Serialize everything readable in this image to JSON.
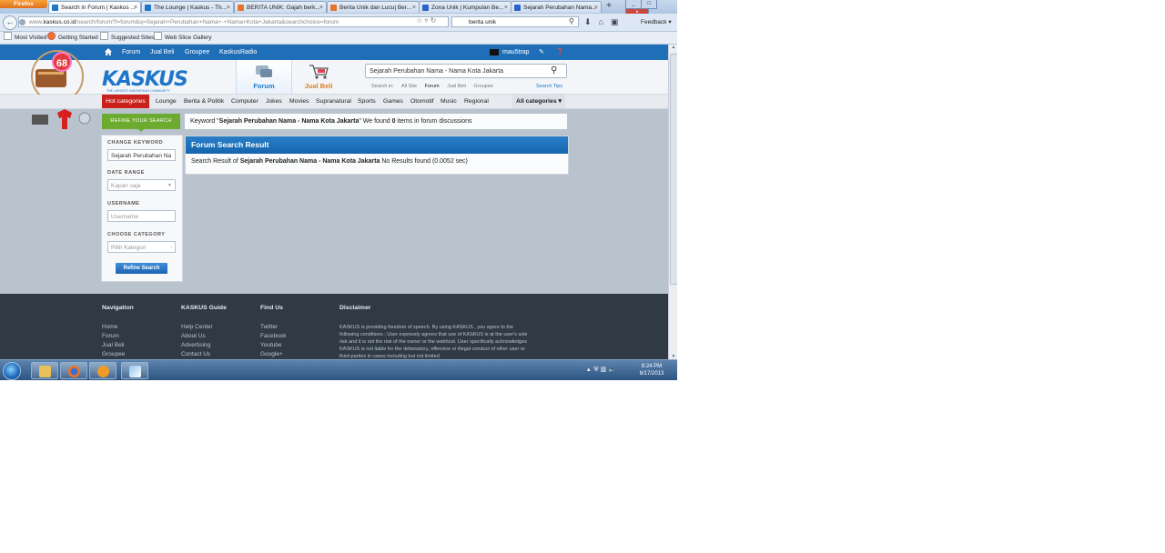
{
  "browser": {
    "app_button": "Firefox",
    "tabs": [
      {
        "title": "Search in Forum | Kaskus ...",
        "color": "#1e75c9"
      },
      {
        "title": "The Lounge | Kaskus - Th...",
        "color": "#1e75c9"
      },
      {
        "title": "BERITA UNIK: Gajah berk...",
        "color": "#e8742a"
      },
      {
        "title": "Berita Unik dan Lucu| Ber...",
        "color": "#e8742a"
      },
      {
        "title": "Zona Unik | Kumpulan Be...",
        "color": "#2a63c9"
      },
      {
        "title": "Sejarah Perubahan Nama...",
        "color": "#2a63c9"
      }
    ],
    "url_prefix": "www.",
    "url_domain": "kaskus.co.id",
    "url_path": "/search/forum?f=forum&q=Sejarah+Perubahan+Nama+-+Nama+Kota+Jakarta&searchchoice=forum",
    "search_value": "berita unik",
    "feedback": "Feedback",
    "bookmarks": [
      "Most Visited",
      "Getting Started",
      "Suggested Sites",
      "Web Slice Gallery"
    ]
  },
  "site": {
    "topnav": [
      "Forum",
      "Jual Beli",
      "Groupee",
      "KaskusRadio"
    ],
    "username": "mau5trap",
    "logo": "KASKUS",
    "logo_tagline": "THE LARGEST INDONESIAN COMMUNITY",
    "anniversary_badge": "68",
    "header_tabs": {
      "forum": "Forum",
      "jual_beli": "Jual Beli"
    },
    "search_value": "Sejarah Perubahan Nama - Nama Kota Jakarta",
    "search_in_label": "Search in:",
    "search_in_options": [
      "All Site",
      "Forum",
      "Jual Beli",
      "Groupee"
    ],
    "search_tips": "Search Tips",
    "hot_categories": "Hot categories",
    "categories": [
      "Lounge",
      "Berita & Politik",
      "Computer",
      "Jokes",
      "Movies",
      "Supranatural",
      "Sports",
      "Games",
      "Otomotif",
      "Music",
      "Regional"
    ],
    "all_categories": "All categories"
  },
  "search": {
    "refine_tag": "REFINE YOUR SEARCH",
    "keyword_prefix": "Keyword \"",
    "keyword": "Sejarah Perubahan Nama - Nama Kota Jakarta",
    "keyword_mid": "\" We found ",
    "found_count": "0",
    "keyword_suffix": " items in forum discussions",
    "sidebar": {
      "change_keyword_label": "CHANGE KEYWORD",
      "keyword_value": "Sejarah Perubahan Na",
      "date_range_label": "DATE RANGE",
      "date_range_value": "Kapan saja",
      "username_label": "USERNAME",
      "username_placeholder": "Username",
      "category_label": "CHOOSE CATEGORY",
      "category_value": "Pilih Kategori",
      "refine_button": "Refine Search"
    },
    "result_title": "Forum Search Result",
    "result_prefix": "Search Result of ",
    "result_keyword": "Sejarah Perubahan Nama - Nama Kota Jakarta",
    "result_suffix": " No Results found (0.0052 sec)"
  },
  "footer": {
    "navigation": {
      "title": "Navigation",
      "links": [
        "Home",
        "Forum",
        "Jual Beli",
        "Groupee"
      ]
    },
    "guide": {
      "title": "KASKUS Guide",
      "links": [
        "Help Center",
        "About Us",
        "Advertising",
        "Contact Us"
      ]
    },
    "find_us": {
      "title": "Find Us",
      "links": [
        "Twitter",
        "Facebook",
        "Youtube",
        "Google+"
      ]
    },
    "disclaimer": {
      "title": "Disclaimer",
      "text": "KASKUS is providing freedom of speech. By using KASKUS , you agree to the following conditions ; User expressly agrees that use of KASKUS is at the user's sole risk and it is not the risk of the owner or the webhost. User specifically acknowledges KASKUS is not liable for the defamatory, offensive or illegal conduct of other user or third-parties in cases including but not limited"
    }
  },
  "taskbar": {
    "time": "8:24 PM",
    "date": "8/17/2013"
  }
}
